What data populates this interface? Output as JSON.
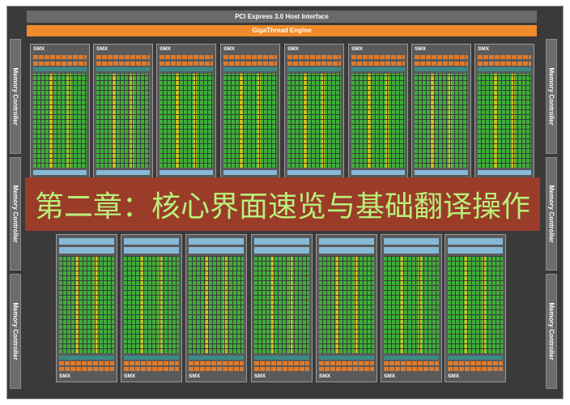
{
  "diagram": {
    "host_interface": "PCI Express 3.0 Host Interface",
    "thread_engine": "GigaThread Engine",
    "memory_controller_label": "Memory Controller",
    "smx_label": "SMX",
    "banner_text": "第二章：核心界面速览与基础翻译操作"
  }
}
